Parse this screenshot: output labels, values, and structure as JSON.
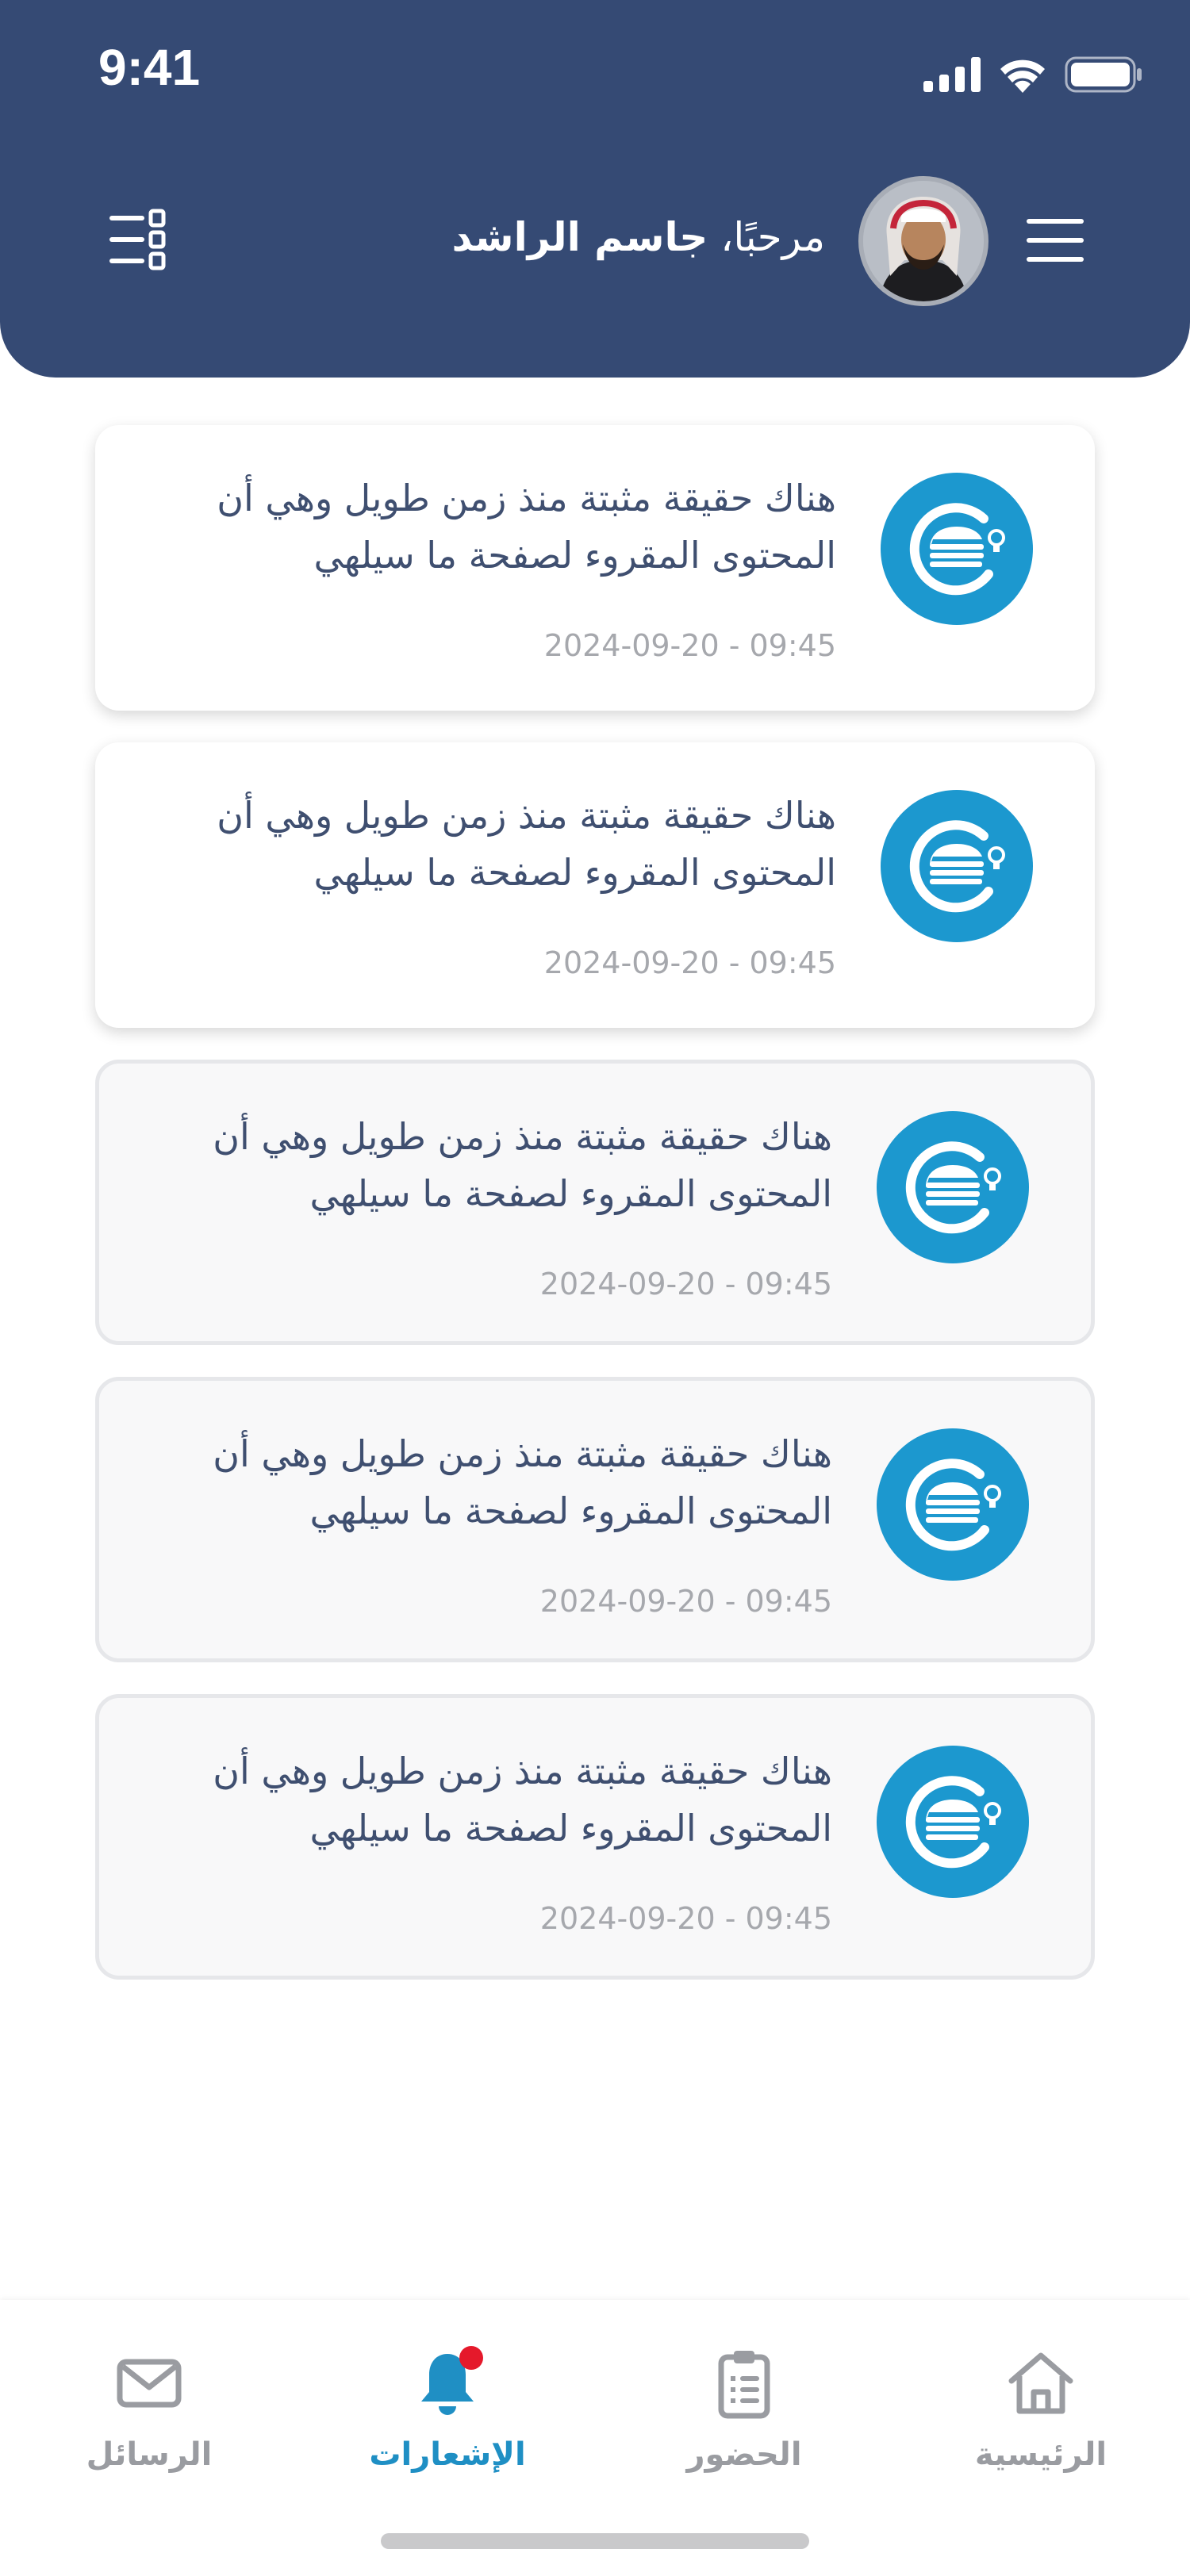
{
  "status_bar": {
    "time": "9:41"
  },
  "header": {
    "greeting_prefix": "مرحبًا،",
    "user_name": "جاسم الراشد"
  },
  "notifications": [
    {
      "text": "هناك حقيقة مثبتة منذ زمن طويل وهي أن المحتوى المقروء لصفحة ما سيلهي",
      "time": "2024-09-20 - 09:45",
      "state": "unread"
    },
    {
      "text": "هناك حقيقة مثبتة منذ زمن طويل وهي أن المحتوى المقروء لصفحة ما سيلهي",
      "time": "2024-09-20 - 09:45",
      "state": "unread"
    },
    {
      "text": "هناك حقيقة مثبتة منذ زمن طويل وهي أن المحتوى المقروء لصفحة ما سيلهي",
      "time": "2024-09-20 - 09:45",
      "state": "read"
    },
    {
      "text": "هناك حقيقة مثبتة منذ زمن طويل وهي أن المحتوى المقروء لصفحة ما سيلهي",
      "time": "2024-09-20 - 09:45",
      "state": "read"
    },
    {
      "text": "هناك حقيقة مثبتة منذ زمن طويل وهي أن المحتوى المقروء لصفحة ما سيلهي",
      "time": "2024-09-20 - 09:45",
      "state": "read"
    }
  ],
  "tabs": [
    {
      "label": "الرئيسية",
      "icon": "home-icon",
      "active": false
    },
    {
      "label": "الحضور",
      "icon": "clipboard-icon",
      "active": false
    },
    {
      "label": "الإشعارات",
      "icon": "bell-icon",
      "active": true,
      "badge": true
    },
    {
      "label": "الرسائل",
      "icon": "mail-icon",
      "active": false
    }
  ],
  "colors": {
    "header_bg": "#354a74",
    "accent": "#1f8fc4",
    "icon_circle": "#1c98cf",
    "badge": "#e5192b",
    "inactive_tab": "#9a9ca1"
  }
}
